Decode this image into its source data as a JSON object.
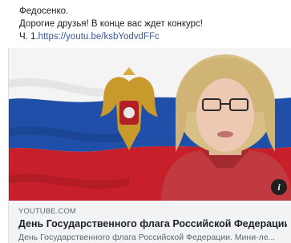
{
  "post": {
    "line1": "Федосенко.",
    "line2": "Дорогие друзья! В конце вас ждет конкурс!",
    "line3_prefix": "Ч. 1.",
    "line3_link": "https://youtu.be/ksbYodvdFFc"
  },
  "link_card": {
    "domain": "YOUTUBE.COM",
    "title": "День Государственного флага Российской Федерации",
    "description": "День Государственного флага Российской Федерации. Мини-ле...",
    "info_icon": "i"
  },
  "colors": {
    "link": "#385898",
    "card_background": "#f2f3f5",
    "flag_white": "#f4f4f4",
    "flag_blue": "#1f4fa8",
    "flag_red": "#c8202a"
  }
}
